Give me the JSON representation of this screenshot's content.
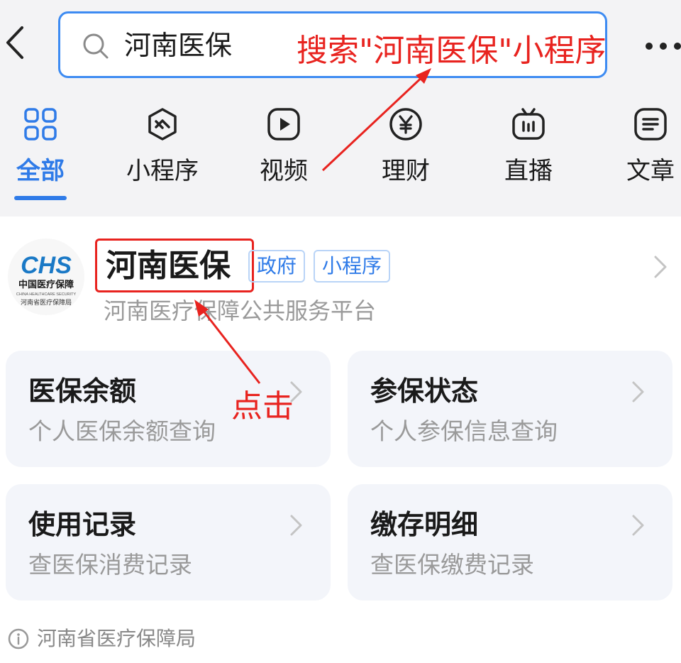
{
  "search": {
    "query": "河南医保"
  },
  "annotations": {
    "search_hint": "搜索\"河南医保\"小程序",
    "click_hint": "点击"
  },
  "tabs": [
    {
      "label": "全部",
      "icon": "grid-icon",
      "active": true
    },
    {
      "label": "小程序",
      "icon": "miniprogram-icon"
    },
    {
      "label": "视频",
      "icon": "play-icon"
    },
    {
      "label": "理财",
      "icon": "yen-icon"
    },
    {
      "label": "直播",
      "icon": "tv-icon"
    },
    {
      "label": "文章",
      "icon": "article-icon"
    }
  ],
  "result": {
    "logo": {
      "brand": "CHS",
      "line1": "中国医疗保障",
      "line2": "CHINA HEALTHCARE SECURITY",
      "line3": "河南省医疗保障局"
    },
    "title": "河南医保",
    "tags": [
      "政府",
      "小程序"
    ],
    "subtitle": "河南医疗保障公共服务平台"
  },
  "cards": [
    {
      "title": "医保余额",
      "subtitle": "个人医保余额查询"
    },
    {
      "title": "参保状态",
      "subtitle": "个人参保信息查询"
    },
    {
      "title": "使用记录",
      "subtitle": "查医保消费记录"
    },
    {
      "title": "缴存明细",
      "subtitle": "查医保缴费记录"
    }
  ],
  "footer": {
    "text": "河南省医疗保障局"
  },
  "colors": {
    "accent": "#2f7be8",
    "search_border": "#3d8bf2",
    "annotation": "#e8231f",
    "card_bg": "#f3f5fa"
  }
}
